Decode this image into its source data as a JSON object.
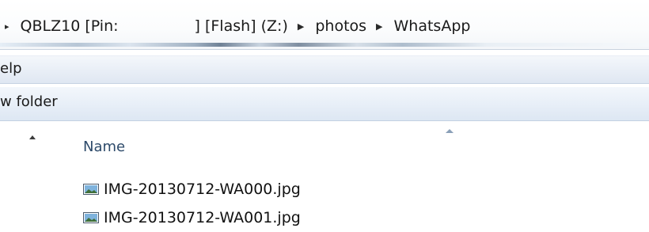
{
  "address_bar": {
    "leading_glyph": "▸",
    "drive_prefix": "QBLZ10 [Pin:",
    "drive_suffix": "] [Flash] (Z:)",
    "separator": "▶",
    "folders": [
      "photos",
      "WhatsApp"
    ]
  },
  "menu": {
    "partial_item": "elp"
  },
  "toolbar": {
    "partial_item": "w folder"
  },
  "file_list": {
    "column_header": "Name",
    "sort_direction": "ascending",
    "files": [
      {
        "name": "IMG-20130712-WA000.jpg",
        "icon": "image-file-icon"
      },
      {
        "name": "IMG-20130712-WA001.jpg",
        "icon": "image-file-icon"
      }
    ]
  },
  "colors": {
    "accent": "#2d4a6a",
    "menu_bar": "#dfe7f2",
    "toolbar": "#dde7f3"
  }
}
